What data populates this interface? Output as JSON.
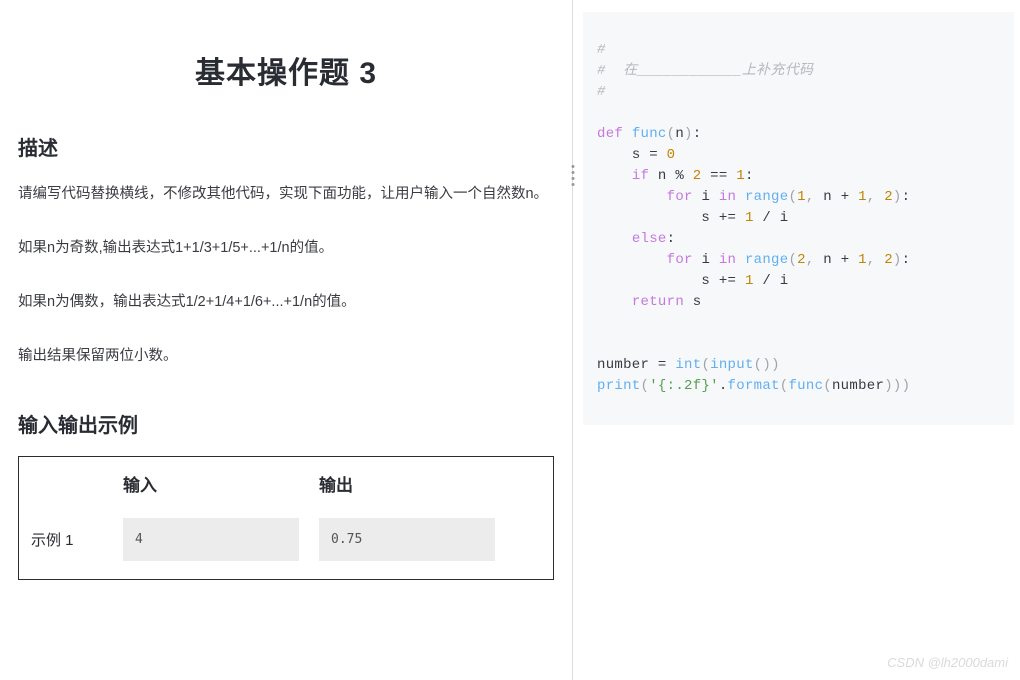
{
  "title": "基本操作题 3",
  "sections": {
    "desc_heading": "描述",
    "io_heading": "输入输出示例"
  },
  "description": {
    "p1": "请编写代码替换横线，不修改其他代码，实现下面功能，让用户输入一个自然数n。",
    "p2": "如果n为奇数,输出表达式1+1/3+1/5+...+1/n的值。",
    "p3": "如果n为偶数，输出表达式1/2+1/4+1/6+...+1/n的值。",
    "p4": "输出结果保留两位小数。"
  },
  "io_table": {
    "header_input": "输入",
    "header_output": "输出",
    "row_label": "示例 1",
    "input_value": "4",
    "output_value": "0.75"
  },
  "code": {
    "c1": "#  ",
    "c2a": "#  在",
    "c2b": "____________",
    "c2c": "上补充代码",
    "c3": "#  ",
    "def": "def",
    "func_name": "func",
    "n": "n",
    "s": "s",
    "eq": "=",
    "zero": "0",
    "if": "if",
    "mod": "%",
    "two": "2",
    "eqeq": "==",
    "one": "1",
    "colon": ":",
    "for": "for",
    "i": "i",
    "in": "in",
    "range": "range",
    "comma": ",",
    "plus": "+",
    "pluseq": "+=",
    "div": "/",
    "else": "else",
    "return": "return",
    "number": "number",
    "int": "int",
    "input": "input",
    "print": "print",
    "fmt": "'{:.2f}'",
    "format": "format",
    "lp": "(",
    "rp": ")"
  },
  "watermark": "CSDN @lh2000dami"
}
